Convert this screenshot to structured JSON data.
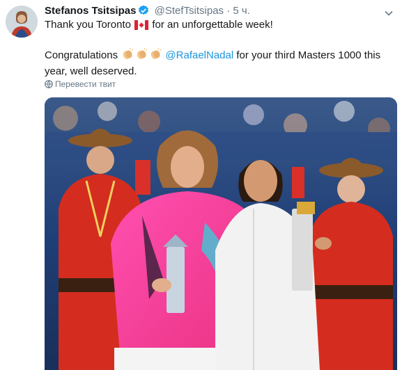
{
  "tweet": {
    "author_name": "Stefanos Tsitsipas",
    "author_handle": "@StefTsitsipas",
    "separator": "·",
    "time": "5 ч.",
    "line1_text": "Thank you Toronto",
    "line1_after": "for an unforgettable week!",
    "line2_before": "Congratulations",
    "mention": "@RafaelNadal",
    "line2_after": "for your third Masters 1000 this year, well deserved.",
    "translate_label": "Перевести твит"
  },
  "icons": {
    "verified": "verified-badge-icon",
    "caret": "chevron-down-icon",
    "flag": "canada-flag-icon",
    "clap": "clapping-hands-icon",
    "globe": "globe-icon"
  },
  "colors": {
    "link": "#1b95e0",
    "secondary_text": "#657786",
    "verified": "#1da1f2"
  }
}
